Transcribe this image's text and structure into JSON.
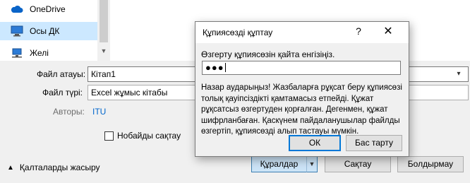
{
  "nav": {
    "items": [
      {
        "label": "OneDrive",
        "icon": "cloud-icon"
      },
      {
        "label": "Осы ДК",
        "icon": "computer-icon"
      },
      {
        "label": "Желі",
        "icon": "network-icon"
      }
    ]
  },
  "form": {
    "filename_label": "Файл атауы:",
    "filename_value": "Кітап1",
    "filetype_label": "Файл түрі:",
    "filetype_value": "Excel жұмыс кітабы",
    "authors_label": "Авторы:",
    "authors_value": "ITU",
    "thumbnail_label": "Нобайды сақтау"
  },
  "footer": {
    "hide_folders": "Қалталарды жасыру",
    "tools": "Құралдар",
    "save": "Сақтау",
    "cancel": "Болдырмау"
  },
  "password_dialog": {
    "title": "Құпиясөзді құптау",
    "help_glyph": "?",
    "close_glyph": "✕",
    "prompt": "Өзгерту құпиясөзін қайта енгізіңіз.",
    "password_mask": "●●●",
    "warning": "Назар аударыңыз! Жазбаларға рұқсат беру құпиясөзі толық қауіпсіздікті қамтамасыз етпейді. Құжат рұқсатсыз өзгертуден қорғалған. Дегенмен, құжат шифрланбаған. Қаскүнем пайдаланушылар файлды өзгертіп, құпиясөзді алып тастауы мүмкін.",
    "ok": "ОК",
    "cancel": "Бас тарту"
  },
  "colors": {
    "accent": "#0078d7",
    "selection": "#cce8ff",
    "link": "#0066cc"
  }
}
